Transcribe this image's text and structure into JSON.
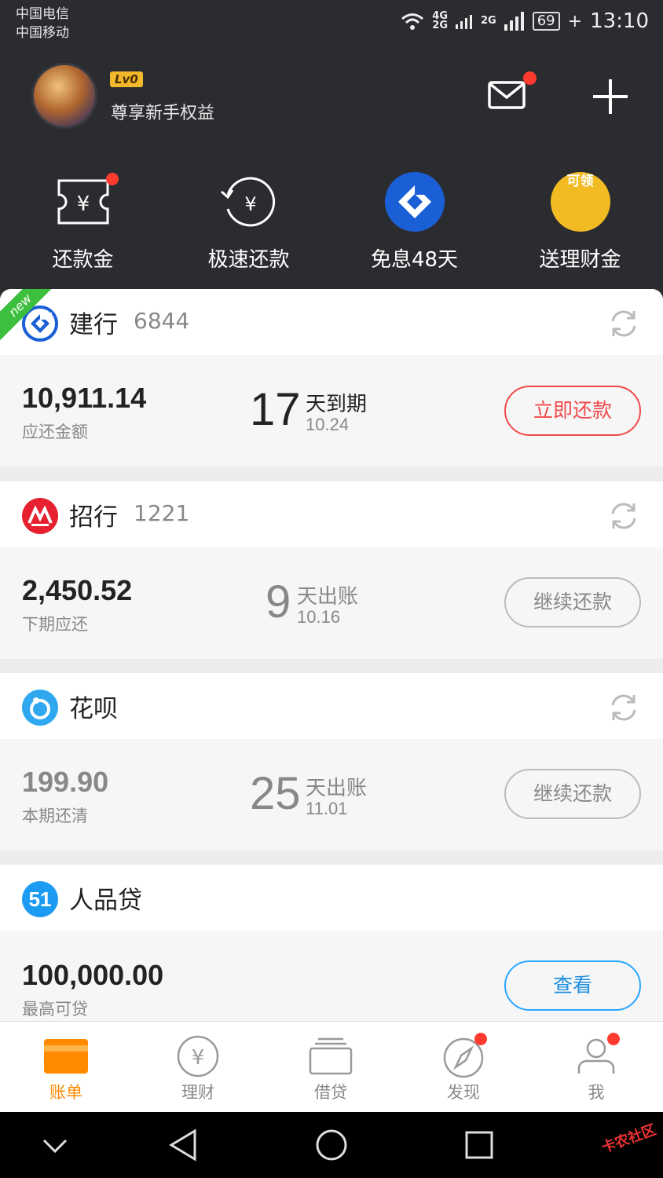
{
  "status_bar": {
    "carrier_1": "中国电信",
    "carrier_2": "中国移动",
    "net_1": "4G",
    "net_2": "2G",
    "net_3": "2G",
    "battery": "69",
    "time": "13:10"
  },
  "header": {
    "level_badge": "Lv0",
    "user_subtitle": "尊享新手权益",
    "mail_has_notification": true
  },
  "quick_actions": [
    {
      "label": "还款金",
      "icon": "yuan-ticket-icon",
      "badge": true
    },
    {
      "label": "极速还款",
      "icon": "fast-repay-icon",
      "badge": false
    },
    {
      "label": "免息48天",
      "icon": "ccb-logo-icon",
      "badge": false
    },
    {
      "label": "送理财金",
      "icon": "coin-icon",
      "badge": false,
      "icon_text": "可领"
    }
  ],
  "cards": [
    {
      "bank": "建行",
      "number": "6844",
      "is_new": true,
      "new_label": "new",
      "amount": "10,911.14",
      "amount_label": "应还金额",
      "days": "17",
      "days_text": "天到期",
      "date": "10.24",
      "button": "立即还款",
      "button_style": "red",
      "muted": false
    },
    {
      "bank": "招行",
      "number": "1221",
      "is_new": false,
      "amount": "2,450.52",
      "amount_label": "下期应还",
      "days": "9",
      "days_text": "天出账",
      "date": "10.16",
      "button": "继续还款",
      "button_style": "gray",
      "muted": false
    },
    {
      "bank": "花呗",
      "number": "",
      "is_new": false,
      "amount": "199.90",
      "amount_label": "本期还清",
      "days": "25",
      "days_text": "天出账",
      "date": "11.01",
      "button": "继续还款",
      "button_style": "gray",
      "muted": true
    },
    {
      "bank": "人品贷",
      "number": "",
      "is_new": false,
      "logo_text": "51",
      "amount": "100,000.00",
      "amount_label": "最高可贷",
      "button": "查看",
      "button_style": "blue",
      "muted": false
    }
  ],
  "tabs": [
    {
      "label": "账单",
      "icon": "bill-icon",
      "active": true,
      "badge": false
    },
    {
      "label": "理财",
      "icon": "yuan-circle-icon",
      "active": false,
      "badge": false
    },
    {
      "label": "借贷",
      "icon": "wallet-icon",
      "active": false,
      "badge": false
    },
    {
      "label": "发现",
      "icon": "compass-icon",
      "active": false,
      "badge": true
    },
    {
      "label": "我",
      "icon": "person-icon",
      "active": false,
      "badge": true
    }
  ],
  "watermark": "卡农社区",
  "colors": {
    "header_bg": "#2b2c30",
    "accent_orange": "#ff8a00",
    "red": "#f04a4a",
    "blue": "#29a6ff",
    "ccb_blue": "#1a5fd6",
    "cmb_red": "#e6202e"
  }
}
